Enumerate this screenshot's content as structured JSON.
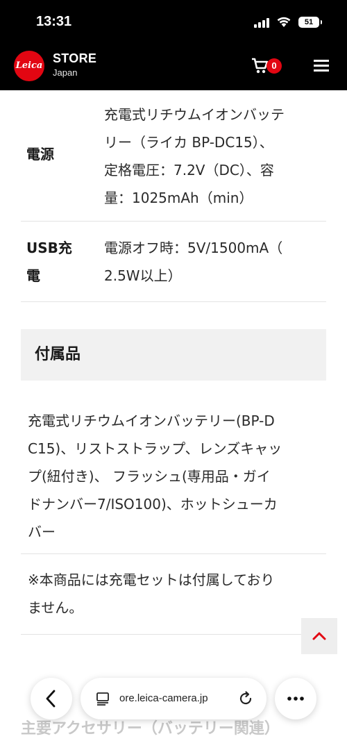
{
  "status_bar": {
    "time": "13:31",
    "battery": "51"
  },
  "header": {
    "logo_text": "Leica",
    "title": "STORE",
    "subtitle": "Japan",
    "cart_count": "0",
    "brand_color": "#e20612"
  },
  "specs": [
    {
      "label": "電源",
      "lines": [
        "充電式リチウムイオンバッテ",
        "リー（ライカ BP-DC15）、",
        "定格電圧：7.2V（DC）、容",
        "量：1025mAh（min）"
      ]
    },
    {
      "label_lines": [
        "USB充",
        "電"
      ],
      "lines": [
        "電源オフ時：5V/1500mA（",
        "2.5W以上）"
      ]
    }
  ],
  "accessories": {
    "heading": "付属品",
    "lines": [
      "充電式リチウムイオンバッテリー(BP-D",
      "C15)、リストストラップ、レンズキャッ",
      "プ(紐付き)、 フラッシュ(専用品・ガイ",
      "ドナンバー7/ISO100)、ホットシューカ",
      "バー"
    ],
    "note_lines": [
      "※本商品には充電セットは付属しており",
      "ません。"
    ]
  },
  "next_section": "主要アクセサリー（バッテリー関連）",
  "browser": {
    "url": "ore.leica-camera.jp"
  },
  "icons": {
    "scroll_top": "chevron-up-icon",
    "back": "chevron-left-icon",
    "more": "ellipsis-icon",
    "reload": "reload-icon",
    "reader": "reader-mode-icon",
    "cart": "cart-icon",
    "menu": "hamburger-menu-icon"
  }
}
